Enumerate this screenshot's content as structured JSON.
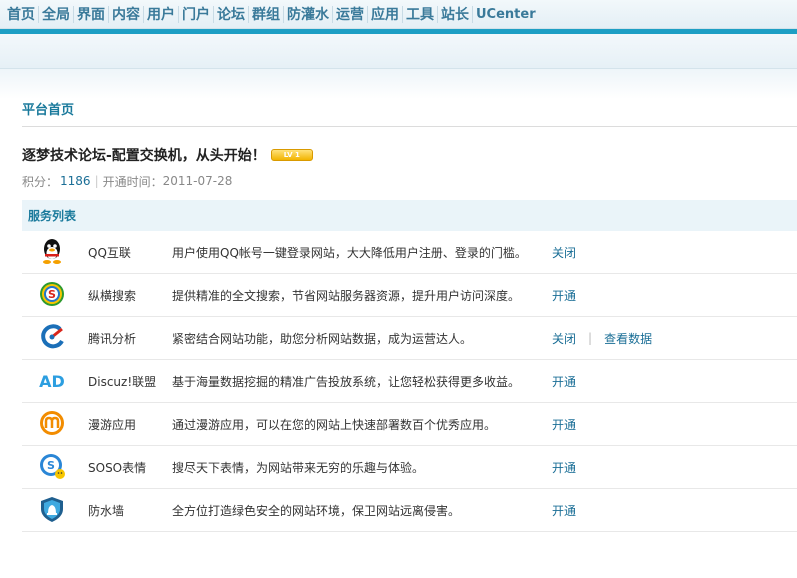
{
  "nav": [
    "首页",
    "全局",
    "界面",
    "内容",
    "用户",
    "门户",
    "论坛",
    "群组",
    "防灌水",
    "运营",
    "应用",
    "工具",
    "站长",
    "UCenter"
  ],
  "page_title": "平台首页",
  "site": {
    "name": "逐梦技术论坛-配置交换机，从头开始！",
    "level": "LV 1"
  },
  "stats": {
    "points_label": "积分：",
    "points": "1186",
    "sep": "|",
    "opened_label": "开通时间：",
    "opened": "2011-07-28"
  },
  "services_header": "服务列表",
  "services": [
    {
      "icon": "qq-icon",
      "name": "QQ互联",
      "desc": "用户使用QQ帐号一键登录网站，大大降低用户注册、登录的门槛。",
      "action": "关闭"
    },
    {
      "icon": "soso-search-icon",
      "name": "纵横搜索",
      "desc": "提供精准的全文搜索，节省网站服务器资源，提升用户访问深度。",
      "action": "开通"
    },
    {
      "icon": "tencent-analytics-icon",
      "name": "腾讯分析",
      "desc": "紧密结合网站功能，助您分析网站数据，成为运营达人。",
      "action": "关闭",
      "extra": "查看数据"
    },
    {
      "icon": "ad-icon",
      "name": "Discuz!联盟",
      "desc": "基于海量数据挖掘的精准广告投放系统，让您轻松获得更多收益。",
      "action": "开通"
    },
    {
      "icon": "manyou-icon",
      "name": "漫游应用",
      "desc": "通过漫游应用，可以在您的网站上快速部署数百个优秀应用。",
      "action": "开通"
    },
    {
      "icon": "soso-emoticon-icon",
      "name": "SOSO表情",
      "desc": "搜尽天下表情，为网站带来无穷的乐趣与体验。",
      "action": "开通"
    },
    {
      "icon": "firewall-shield-icon",
      "name": "防水墙",
      "desc": "全方位打造绿色安全的网站环境，保卫网站远离侵害。",
      "action": "开通"
    }
  ]
}
